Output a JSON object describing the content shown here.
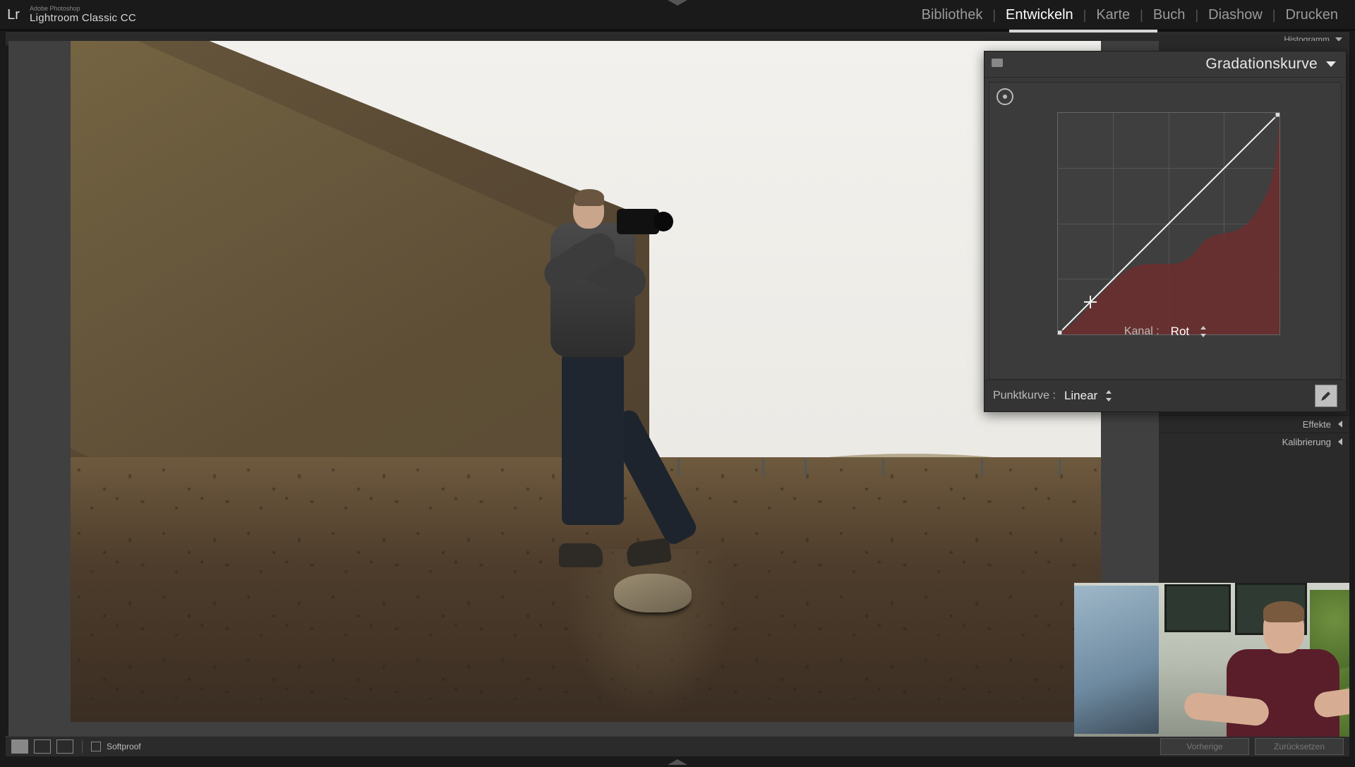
{
  "app": {
    "vendor": "Adobe Photoshop",
    "name": "Lightroom Classic CC",
    "logo": "Lr"
  },
  "modules": {
    "items": [
      "Bibliothek",
      "Entwickeln",
      "Karte",
      "Buch",
      "Diashow",
      "Drucken"
    ],
    "active_index": 1
  },
  "histogram": {
    "label": "Histogramm"
  },
  "right_panel": {
    "rows": [
      {
        "label": "Effekte"
      },
      {
        "label": "Kalibrierung"
      }
    ]
  },
  "tone_curve": {
    "title": "Gradationskurve",
    "channel_label": "Kanal :",
    "channel_value": "Rot",
    "point_curve_label": "Punktkurve :",
    "point_curve_value": "Linear"
  },
  "toolbar": {
    "softproof": "Softproof"
  },
  "footer_buttons": {
    "prev": "Vorherige",
    "reset": "Zurücksetzen"
  },
  "colors": {
    "panel": "#383838",
    "accent_red": "#6e2e2e",
    "text": "#e8e8e8"
  }
}
